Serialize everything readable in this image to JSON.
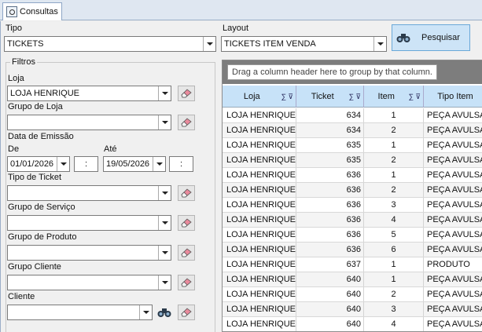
{
  "tab": {
    "label": "Consultas"
  },
  "tipo": {
    "label": "Tipo",
    "value": "TICKETS"
  },
  "layout": {
    "label": "Layout",
    "value": "TICKETS ITEM VENDA"
  },
  "search_button": {
    "label": "Pesquisar"
  },
  "filtros": {
    "title": "Filtros",
    "loja": {
      "label": "Loja",
      "value": "LOJA HENRIQUE"
    },
    "grupo_loja": {
      "label": "Grupo de Loja",
      "value": ""
    },
    "data_emissao": {
      "label": "Data de Emissão",
      "de_label": "De",
      "ate_label": "Até",
      "de_date": "01/01/2026",
      "ate_date": "19/05/2026",
      "de_time": ":",
      "ate_time": ":"
    },
    "tipo_ticket": {
      "label": "Tipo de Ticket",
      "value": ""
    },
    "grupo_servico": {
      "label": "Grupo de Serviço",
      "value": ""
    },
    "grupo_produto": {
      "label": "Grupo de Produto",
      "value": ""
    },
    "grupo_cliente": {
      "label": "Grupo Cliente",
      "value": ""
    },
    "cliente": {
      "label": "Cliente",
      "value": ""
    }
  },
  "grid": {
    "group_hint": "Drag a column header here to group by that column.",
    "columns": [
      {
        "label": "Loja",
        "icons": ""
      },
      {
        "label": "Ticket",
        "icons": "∑ ⊽"
      },
      {
        "label": "Item",
        "icons": "∑ ⊽"
      },
      {
        "label": "Tipo Item",
        "icons": ""
      }
    ],
    "rows": [
      [
        "LOJA HENRIQUE",
        "634",
        "1",
        "PEÇA AVULSA"
      ],
      [
        "LOJA HENRIQUE",
        "634",
        "2",
        "PEÇA AVULSA"
      ],
      [
        "LOJA HENRIQUE",
        "635",
        "1",
        "PEÇA AVULSA"
      ],
      [
        "LOJA HENRIQUE",
        "635",
        "2",
        "PEÇA AVULSA"
      ],
      [
        "LOJA HENRIQUE",
        "636",
        "1",
        "PEÇA AVULSA"
      ],
      [
        "LOJA HENRIQUE",
        "636",
        "2",
        "PEÇA AVULSA"
      ],
      [
        "LOJA HENRIQUE",
        "636",
        "3",
        "PEÇA AVULSA"
      ],
      [
        "LOJA HENRIQUE",
        "636",
        "4",
        "PEÇA AVULSA"
      ],
      [
        "LOJA HENRIQUE",
        "636",
        "5",
        "PEÇA AVULSA"
      ],
      [
        "LOJA HENRIQUE",
        "636",
        "6",
        "PEÇA AVULSA"
      ],
      [
        "LOJA HENRIQUE",
        "637",
        "1",
        "PRODUTO"
      ],
      [
        "LOJA HENRIQUE",
        "640",
        "1",
        "PEÇA AVULSA"
      ],
      [
        "LOJA HENRIQUE",
        "640",
        "2",
        "PEÇA AVULSA"
      ],
      [
        "LOJA HENRIQUE",
        "640",
        "3",
        "PEÇA AVULSA"
      ],
      [
        "LOJA HENRIQUE",
        "640",
        "4",
        "PEÇA AVULSA"
      ]
    ]
  }
}
